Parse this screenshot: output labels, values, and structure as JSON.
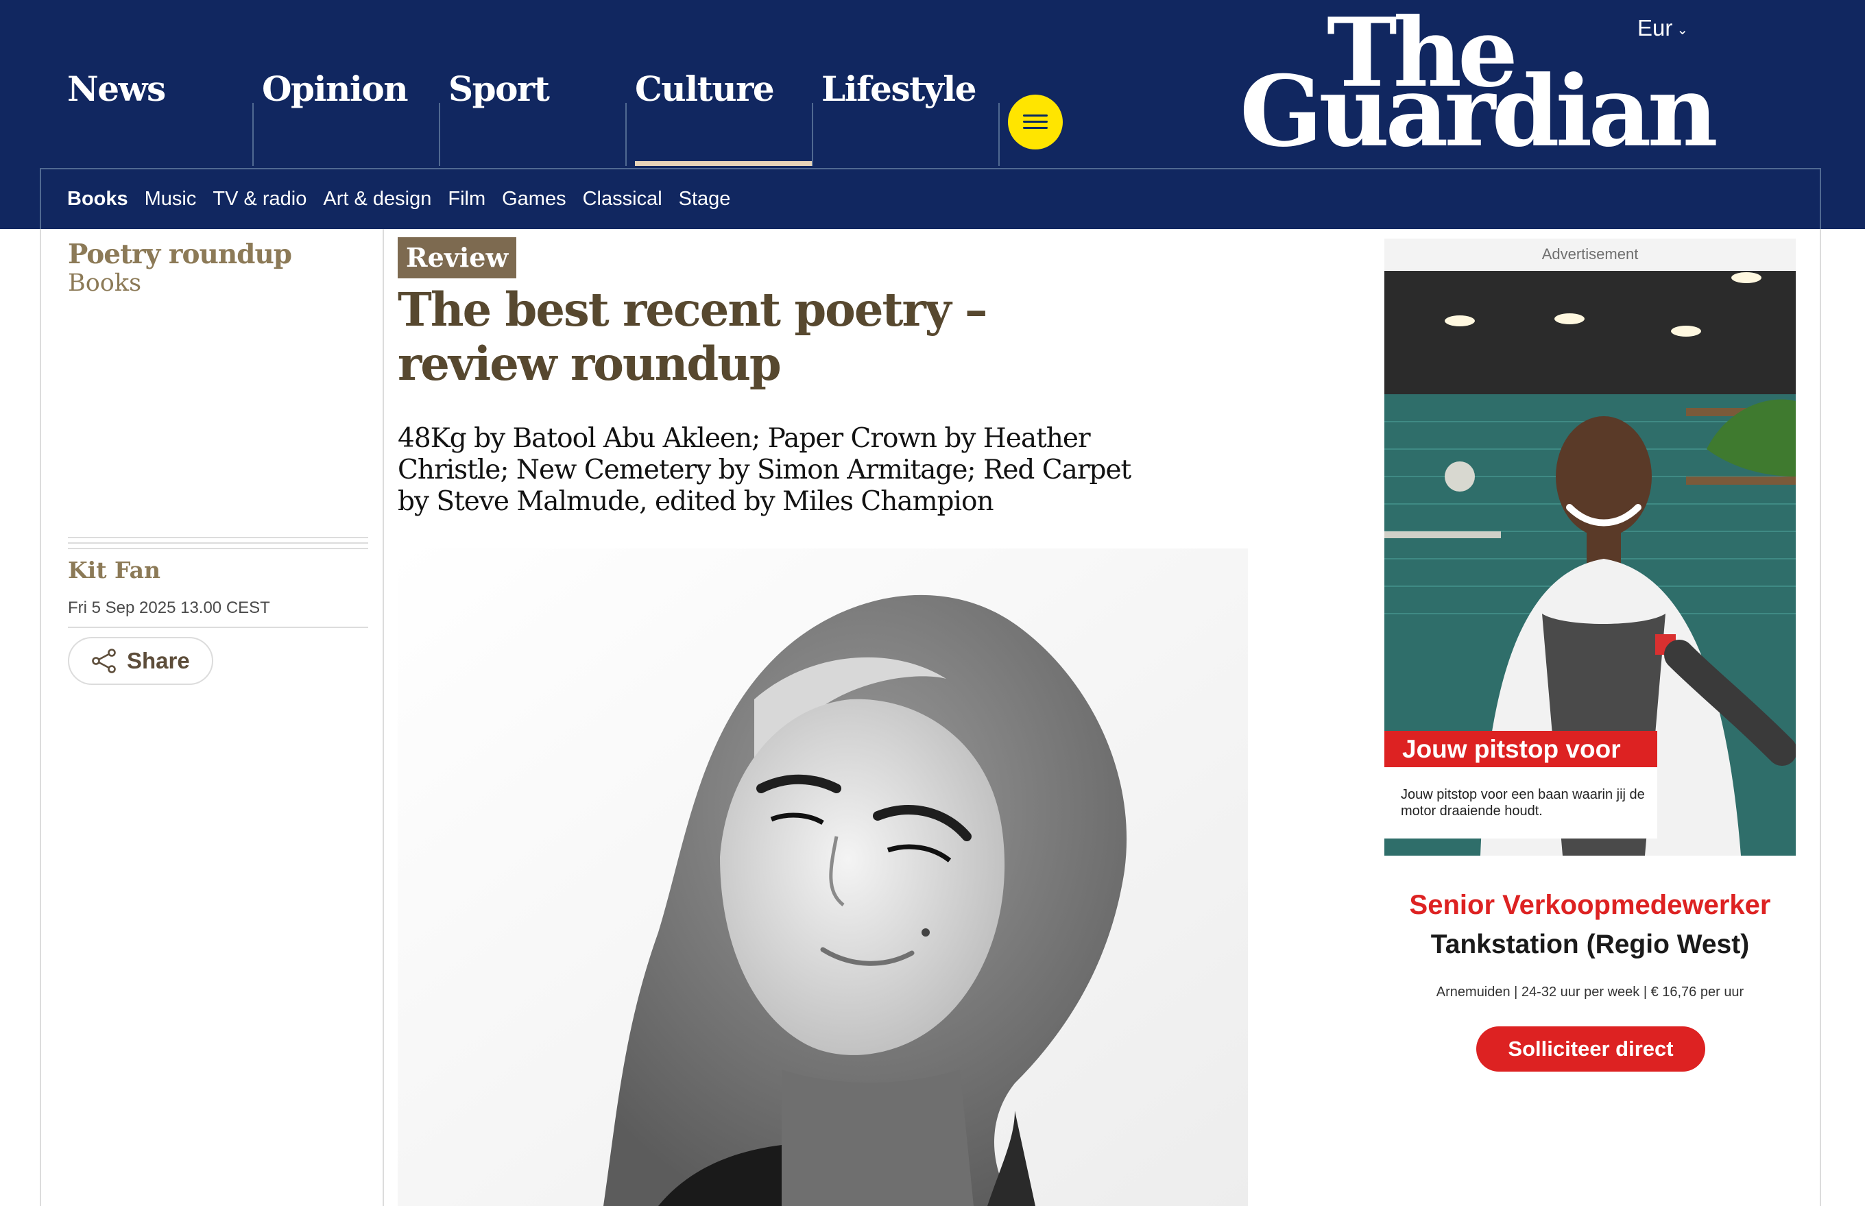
{
  "header": {
    "edition": "Eur",
    "logo": {
      "line1": "The",
      "line2": "Guardian"
    },
    "pillars": [
      {
        "label": "News"
      },
      {
        "label": "Opinion"
      },
      {
        "label": "Sport"
      },
      {
        "label": "Culture",
        "active": true
      },
      {
        "label": "Lifestyle"
      }
    ],
    "subnav": [
      "Books",
      "Music",
      "TV & radio",
      "Art & design",
      "Film",
      "Games",
      "Classical",
      "Stage"
    ]
  },
  "article": {
    "series": "Poetry roundup",
    "section": "Books",
    "badge": "Review",
    "headline": "The best recent poetry – review roundup",
    "standfirst": "48Kg by Batool Abu Akleen; Paper Crown by Heather Christle; New Cemetery by Simon Armitage; Red Carpet by Steve Malmude, edited by Miles Champion",
    "author": "Kit Fan",
    "date": "Fri 5 Sep 2025 13.00 CEST",
    "share_label": "Share"
  },
  "ad": {
    "label": "Advertisement",
    "banner": "Jouw pitstop voor",
    "tagline": "Jouw pitstop voor een baan waarin jij de motor draaiende houdt.",
    "title": "Senior Verkoopmedewerker",
    "subtitle": "Tankstation (Regio West)",
    "meta": "Arnemuiden | 24-32 uur per week | € 16,76 per uur",
    "cta": "Solliciteer direct"
  },
  "colors": {
    "header_bg": "#112760",
    "culture_accent": "#e7d4b9",
    "menu_button": "#ffe500",
    "review_badge": "#7d6a50",
    "headline": "#57482f",
    "ad_red": "#dd2222"
  },
  "icons": {
    "menu": "hamburger-icon",
    "share": "share-icon",
    "edition": "chevron-down-icon"
  }
}
